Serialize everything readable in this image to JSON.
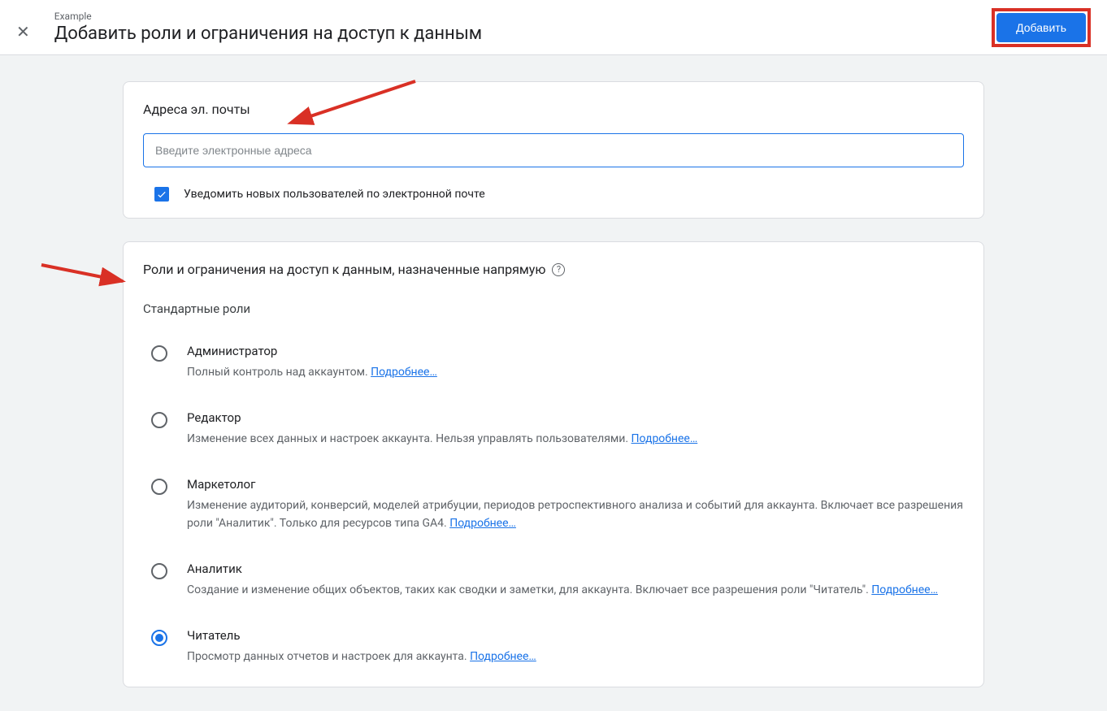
{
  "header": {
    "breadcrumb": "Example",
    "title": "Добавить роли и ограничения на доступ к данным",
    "add_button": "Добавить"
  },
  "email_card": {
    "title": "Адреса эл. почты",
    "placeholder": "Введите электронные адреса",
    "notify_label": "Уведомить новых пользователей по электронной почте",
    "notify_checked": true
  },
  "roles_card": {
    "title": "Роли и ограничения на доступ к данным, назначенные напрямую",
    "subtitle": "Стандартные роли",
    "more_link": "Подробнее…",
    "roles": [
      {
        "name": "Администратор",
        "desc": "Полный контроль над аккаунтом. ",
        "selected": false
      },
      {
        "name": "Редактор",
        "desc": "Изменение всех данных и настроек аккаунта. Нельзя управлять пользователями. ",
        "selected": false
      },
      {
        "name": "Маркетолог",
        "desc": "Изменение аудиторий, конверсий, моделей атрибуции, периодов ретроспективного анализа и событий для аккаунта. Включает все разрешения роли \"Аналитик\". Только для ресурсов типа GA4. ",
        "selected": false
      },
      {
        "name": "Аналитик",
        "desc": "Создание и изменение общих объектов, таких как сводки и заметки, для аккаунта. Включает все разрешения роли \"Читатель\". ",
        "selected": false
      },
      {
        "name": "Читатель",
        "desc": "Просмотр данных отчетов и настроек для аккаунта. ",
        "selected": true
      }
    ]
  }
}
